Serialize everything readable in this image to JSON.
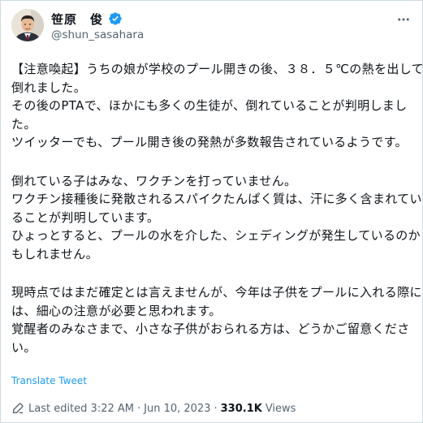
{
  "author": {
    "display_name": "笹原　俊",
    "handle": "@shun_sasahara",
    "verified": true
  },
  "tweet": {
    "paragraphs": [
      [
        "【注意喚起】うちの娘が学校のプール開きの後、３８．５℃の熱を出して",
        "倒れました。",
        "その後のPTAで、ほかにも多くの生徒が、倒れていることが判明しまし",
        "た。",
        "ツイッターでも、プール開き後の発熱が多数報告されているようです。"
      ],
      [
        "倒れている子はみな、ワクチンを打っていません。",
        "ワクチン接種後に発散されるスパイクたんぱく質は、汗に多く含まれてい",
        "ることが判明しています。",
        "ひょっとすると、プールの水を介した、シェディングが発生しているのか",
        "もしれません。"
      ],
      [
        "現時点ではまだ確定とは言えませんが、今年は子供をプールに入れる際に",
        "は、細心の注意が必要と思われます。",
        "覚醒者のみなさまで、小さな子供がおられる方は、どうかご留意くださ",
        "い。"
      ]
    ],
    "translate_label": "Translate Tweet",
    "edited_label": "Last edited 3:22 AM",
    "separator": "·",
    "date": "Jun 10, 2023",
    "views_count": "330.1K",
    "views_label": "Views"
  },
  "colors": {
    "text": "#0f1419",
    "secondary": "#536471",
    "link": "#1d9bf0",
    "verified": "#1d9bf0"
  },
  "icons": [
    "avatar",
    "verified-badge-icon",
    "more-options-icon",
    "pencil-icon"
  ]
}
